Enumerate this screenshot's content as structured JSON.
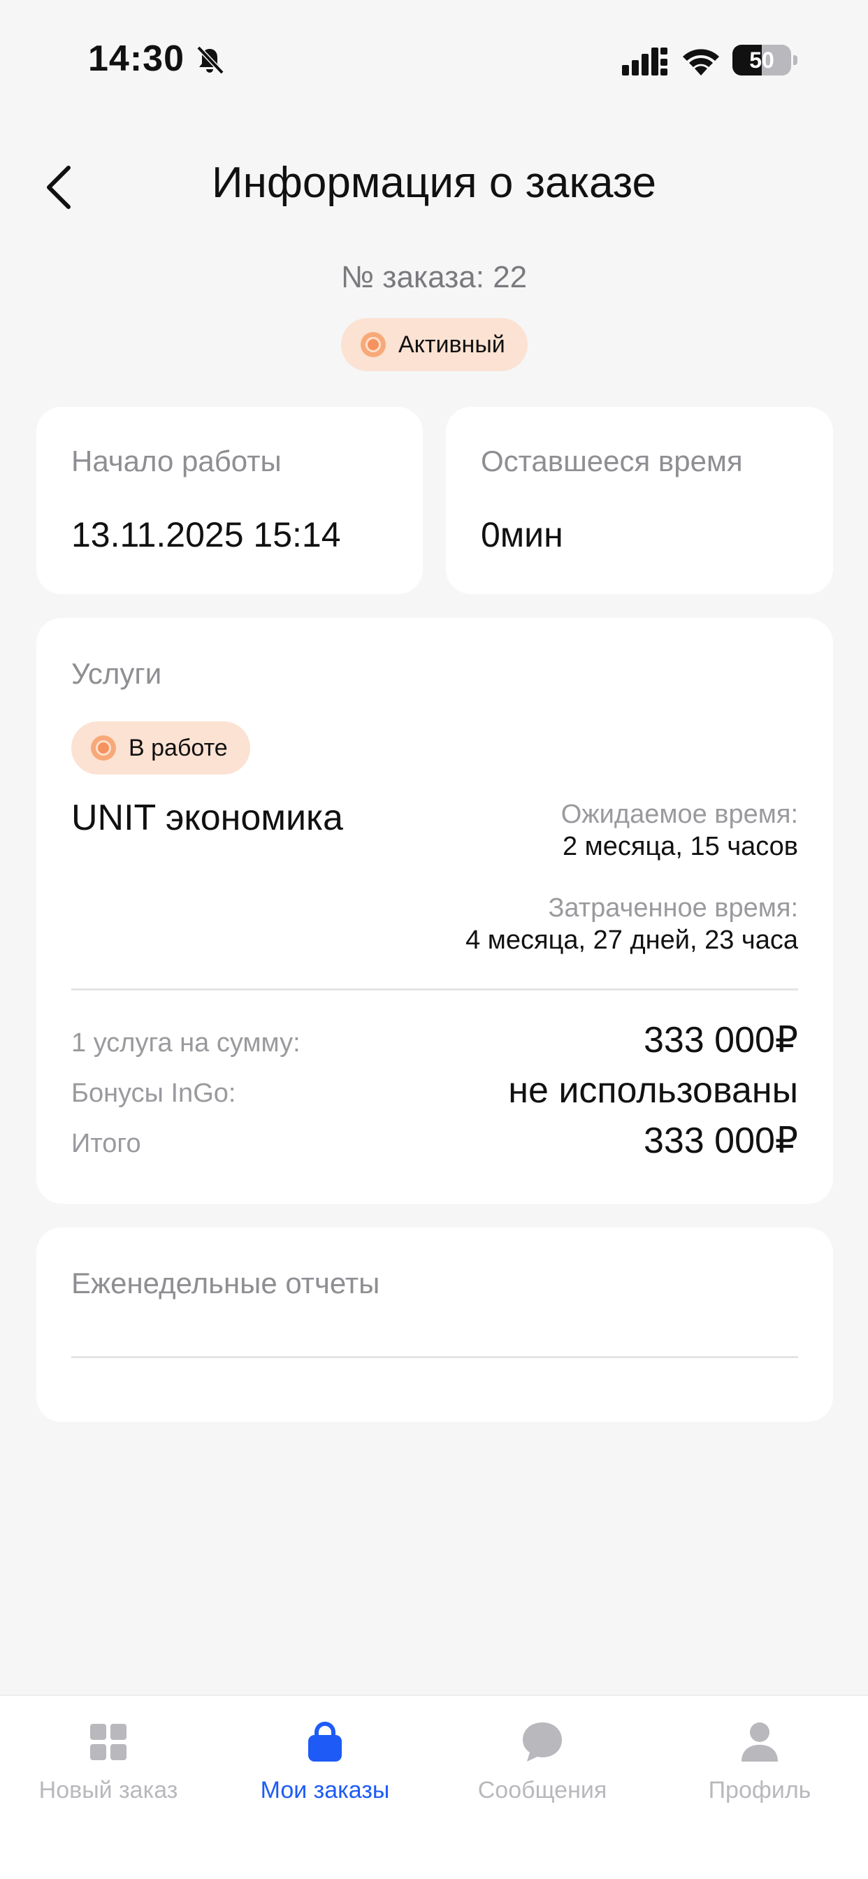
{
  "status_bar": {
    "time": "14:30",
    "battery_text": "50",
    "battery_level": 0.5
  },
  "header": {
    "title": "Информация о заказе"
  },
  "order": {
    "number_label": "№ заказа: 22",
    "status": "Активный"
  },
  "cards": {
    "start": {
      "label": "Начало работы",
      "value": "13.11.2025 15:14"
    },
    "remaining": {
      "label": "Оставшееся время",
      "value": "0мин"
    }
  },
  "services": {
    "title": "Услуги",
    "status": "В работе",
    "name": "UNIT экономика",
    "expected_label": "Ожидаемое время:",
    "expected_value": "2 месяца, 15 часов",
    "spent_label": "Затраченное время:",
    "spent_value": "4 месяца, 27 дней, 23 часа",
    "sum_label": "1 услуга на сумму:",
    "sum_value": "333 000₽",
    "bonus_label": "Бонусы InGo:",
    "bonus_value": "не использованы",
    "total_label": "Итого",
    "total_value": "333 000₽"
  },
  "weekly_reports": {
    "title": "Еженедельные отчеты"
  },
  "bottom_nav": {
    "items": [
      {
        "label": "Новый заказ",
        "icon": "grid-icon",
        "active": false
      },
      {
        "label": "Мои заказы",
        "icon": "bag-icon",
        "active": true
      },
      {
        "label": "Сообщения",
        "icon": "chat-bubble-icon",
        "active": false
      },
      {
        "label": "Профиль",
        "icon": "person-icon",
        "active": false
      }
    ]
  },
  "colors": {
    "background": "#f6f6f7",
    "card": "#ffffff",
    "accent_blue": "#1e5bf6",
    "badge_bg": "#fbe2d2",
    "badge_dot": "#f6925d",
    "muted_text": "#8e8e93",
    "inactive_nav": "#b8b8bd"
  }
}
